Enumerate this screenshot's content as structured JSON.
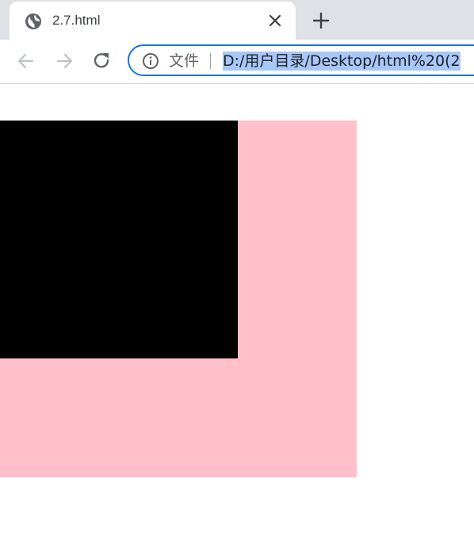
{
  "tab": {
    "title": "2.7.html",
    "favicon": "globe-icon"
  },
  "toolbar": {
    "back_icon": "arrow-left-icon",
    "forward_icon": "arrow-right-icon",
    "reload_icon": "reload-icon",
    "new_tab_icon": "plus-icon",
    "close_icon": "close-icon"
  },
  "omnibox": {
    "info_icon": "info-icon",
    "scheme_label": "文件",
    "url": "D:/用户目录/Desktop/html%20(2"
  },
  "page": {
    "outer_box_color": "#ffc0cb",
    "inner_box_color": "#000000"
  },
  "colors": {
    "tabstrip": "#dee1e6",
    "focus_ring": "#1a73e8",
    "selection": "#a8c7fa"
  }
}
